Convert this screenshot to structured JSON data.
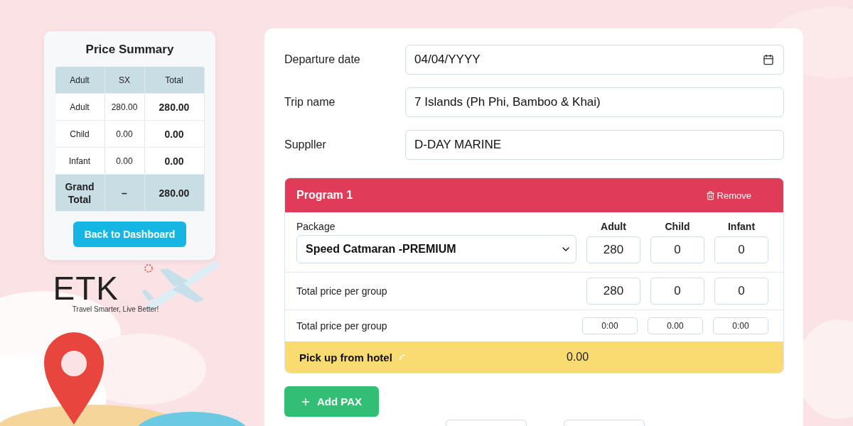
{
  "summary": {
    "title": "Price Summary",
    "columns": [
      "Adult",
      "SX",
      "Total"
    ],
    "rows": [
      {
        "label": "Adult",
        "sx": "280.00",
        "total": "280.00"
      },
      {
        "label": "Child",
        "sx": "0.00",
        "total": "0.00"
      },
      {
        "label": "Infant",
        "sx": "0.00",
        "total": "0.00"
      }
    ],
    "grand": {
      "label": "Grand Total",
      "sx": "–",
      "total": "280.00"
    },
    "button": "Back to Dashboard"
  },
  "logo": {
    "name": "ETK",
    "tagline": "Travel Smarter, Live Better!"
  },
  "fields": [
    {
      "label": "Departure date",
      "value": "04/04/YYYY",
      "kind": "date"
    },
    {
      "label": "Trip name",
      "value": "7 Islands (Ph Phi, Bamboo & Khai)",
      "kind": "text"
    },
    {
      "label": "Suppller",
      "value": "D-DAY MARINE",
      "kind": "text"
    }
  ],
  "program": {
    "title": "Program 1",
    "remove": "Remove",
    "package_label": "Package",
    "package": "Speed Catmaran -PREMIUM",
    "columns": [
      "Adult",
      "Child",
      "Infant"
    ],
    "prices": [
      "280",
      "0",
      "0"
    ],
    "rows": [
      {
        "label": "Total price per group",
        "values": [
          "280",
          "0",
          "0"
        ],
        "kind": "large"
      },
      {
        "label": "Total price per group",
        "values": [
          "0:00",
          "0.00",
          "0:00"
        ],
        "kind": "small"
      }
    ],
    "pickup": {
      "label": "Pick up from hotel",
      "value": "0.00"
    }
  },
  "add_button": "Add PAX"
}
